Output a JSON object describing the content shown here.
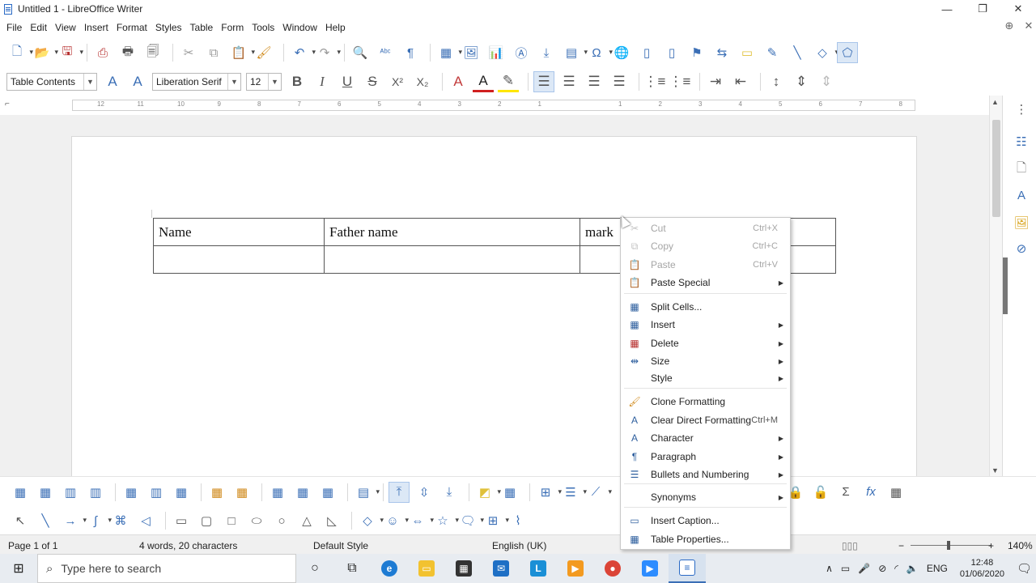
{
  "window": {
    "title": "Untitled 1 - LibreOffice Writer",
    "minimize": "—",
    "restore": "❐",
    "close": "✕"
  },
  "menubar": {
    "items": [
      "File",
      "Edit",
      "View",
      "Insert",
      "Format",
      "Styles",
      "Table",
      "Form",
      "Tools",
      "Window",
      "Help"
    ]
  },
  "formatting": {
    "paragraph_style": "Table Contents",
    "font_name": "Liberation Serif",
    "font_size": "12"
  },
  "ruler": {
    "numbers": [
      "12",
      "11",
      "10",
      "9",
      "8",
      "7",
      "6",
      "5",
      "4",
      "3",
      "2",
      "1",
      "1",
      "2",
      "3",
      "4",
      "5",
      "6",
      "7",
      "8"
    ]
  },
  "table": {
    "rows": [
      [
        "Name",
        "Father name",
        "mark",
        ""
      ],
      [
        "",
        "",
        "",
        ""
      ]
    ]
  },
  "context_menu": {
    "items": [
      {
        "label": "Cut",
        "shortcut": "Ctrl+X",
        "icon": "cut-icon",
        "disabled": true
      },
      {
        "label": "Copy",
        "shortcut": "Ctrl+C",
        "icon": "copy-icon",
        "disabled": true
      },
      {
        "label": "Paste",
        "shortcut": "Ctrl+V",
        "icon": "paste-icon",
        "disabled": true
      },
      {
        "label": "Paste Special",
        "shortcut": "",
        "icon": "paste-special-icon",
        "submenu": true
      },
      {
        "label": "Split Cells...",
        "shortcut": "",
        "icon": "split-cells-icon"
      },
      {
        "label": "Insert",
        "shortcut": "",
        "icon": "insert-table-icon",
        "submenu": true
      },
      {
        "label": "Delete",
        "shortcut": "",
        "icon": "delete-table-icon",
        "submenu": true
      },
      {
        "label": "Size",
        "shortcut": "",
        "icon": "size-icon",
        "submenu": true
      },
      {
        "label": "Style",
        "shortcut": "",
        "icon": "",
        "submenu": true
      },
      {
        "label": "Clone Formatting",
        "shortcut": "",
        "icon": "clone-formatting-icon"
      },
      {
        "label": "Clear Direct Formatting",
        "shortcut": "Ctrl+M",
        "icon": "clear-formatting-icon"
      },
      {
        "label": "Character",
        "shortcut": "",
        "icon": "character-icon",
        "submenu": true
      },
      {
        "label": "Paragraph",
        "shortcut": "",
        "icon": "paragraph-icon",
        "submenu": true
      },
      {
        "label": "Bullets and Numbering",
        "shortcut": "",
        "icon": "bullets-icon",
        "submenu": true
      },
      {
        "label": "Synonyms",
        "shortcut": "",
        "icon": "",
        "submenu": true
      },
      {
        "label": "Insert Caption...",
        "shortcut": "",
        "icon": "caption-icon"
      },
      {
        "label": "Table Properties...",
        "shortcut": "",
        "icon": "table-properties-icon"
      }
    ]
  },
  "statusbar": {
    "page": "Page 1 of 1",
    "words": "4 words, 20 characters",
    "page_style": "Default Style",
    "language": "English (UK)",
    "zoom": "140%"
  },
  "taskbar": {
    "search_placeholder": "Type here to search",
    "language": "ENG",
    "time": "12:48",
    "date": "01/06/2020"
  },
  "colors": {
    "accent": "#3b6fb6",
    "disabled_text": "#a5a5a5"
  }
}
